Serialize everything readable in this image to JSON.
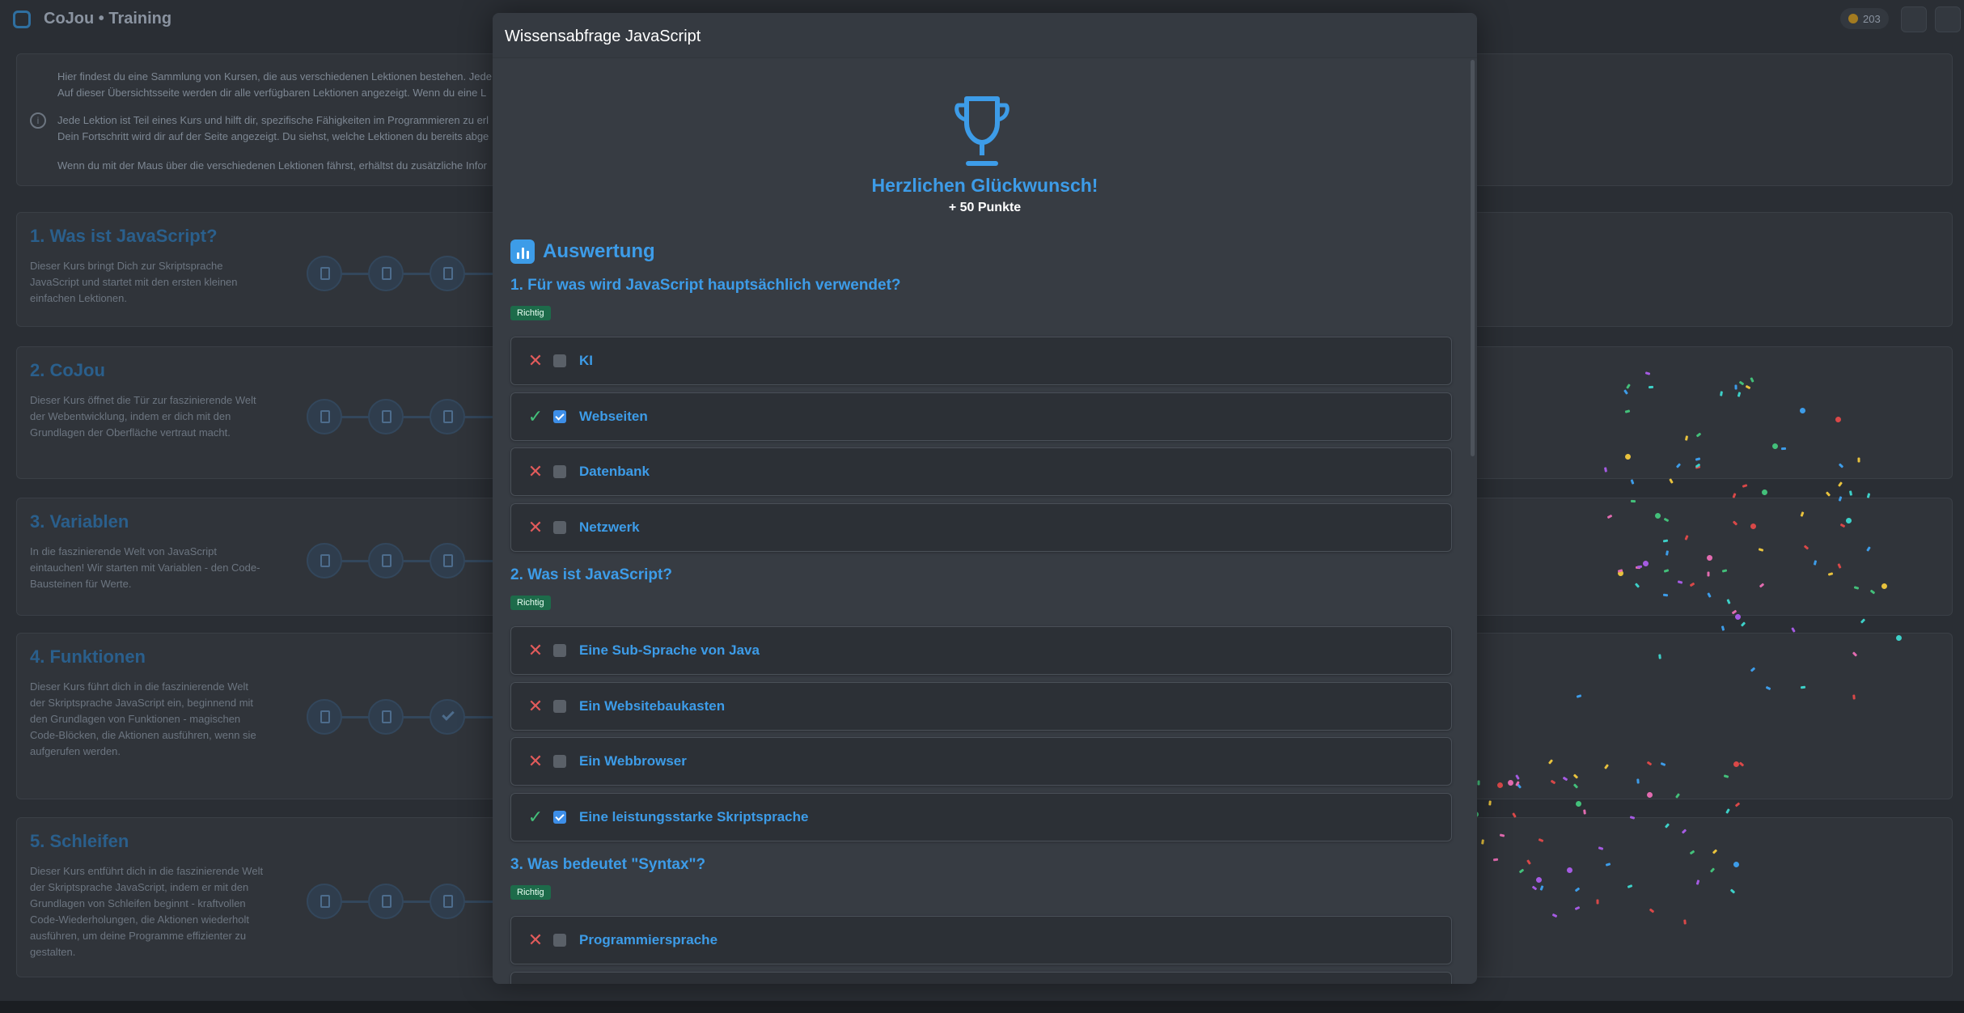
{
  "app": {
    "brand": "CoJou • Training",
    "points_badge": "203"
  },
  "info": {
    "lines": [
      "Hier findest du eine Sammlung von Kursen, die aus verschiedenen Lektionen bestehen. Jede",
      "Auf dieser Übersichtsseite werden dir alle verfügbaren Lektionen angezeigt. Wenn du eine L",
      "Jede Lektion ist Teil eines Kurs und hilft dir, spezifische Fähigkeiten im Programmieren zu erl",
      "Dein Fortschritt wird dir auf der Seite angezeigt. Du siehst, welche Lektionen du bereits abge",
      "Wenn du mit der Maus über die verschiedenen Lektionen fährst, erhältst du zusätzliche Infor"
    ]
  },
  "courses": [
    {
      "title": "1. Was ist JavaScript?",
      "desc": "Dieser Kurs bringt Dich zur Skriptsprache JavaScript und startet mit den ersten kleinen einfachen Lektionen."
    },
    {
      "title": "2. CoJou",
      "desc": "Dieser Kurs öffnet die Tür zur faszinierende Welt der Webentwicklung, indem er dich mit den Grundlagen der Oberfläche vertraut macht."
    },
    {
      "title": "3. Variablen",
      "desc": "In die faszinierende Welt von JavaScript eintauchen! Wir starten mit Variablen - den Code-Bausteinen für Werte."
    },
    {
      "title": "4. Funktionen",
      "desc": "Dieser Kurs führt dich in die faszinierende Welt der Skriptsprache JavaScript ein, beginnend mit den Grundlagen von Funktionen - magischen Code-Blöcken, die Aktionen ausführen, wenn sie aufgerufen werden."
    },
    {
      "title": "5. Schleifen",
      "desc": "Dieser Kurs entführt dich in die faszinierende Welt der Skriptsprache JavaScript, indem er mit den Grundlagen von Schleifen beginnt - kraftvollen Code-Wiederholungen, die Aktionen wiederholt ausführen, um deine Programme effizienter zu gestalten."
    }
  ],
  "modal": {
    "title": "Wissensabfrage JavaScript",
    "congrats": "Herzlichen Glückwunsch!",
    "points": "+ 50 Punkte",
    "evaluation_title": "Auswertung",
    "questions": [
      {
        "text": "1. Für was wird JavaScript hauptsächlich verwendet?",
        "status": "Richtig",
        "answers": [
          {
            "label": "KI",
            "correct": false,
            "checked": false
          },
          {
            "label": "Webseiten",
            "correct": true,
            "checked": true
          },
          {
            "label": "Datenbank",
            "correct": false,
            "checked": false
          },
          {
            "label": "Netzwerk",
            "correct": false,
            "checked": false
          }
        ]
      },
      {
        "text": "2. Was ist JavaScript?",
        "status": "Richtig",
        "answers": [
          {
            "label": "Eine Sub-Sprache von Java",
            "correct": false,
            "checked": false
          },
          {
            "label": "Ein Websitebaukasten",
            "correct": false,
            "checked": false
          },
          {
            "label": "Ein Webbrowser",
            "correct": false,
            "checked": false
          },
          {
            "label": "Eine leistungsstarke Skriptsprache",
            "correct": true,
            "checked": true
          }
        ]
      },
      {
        "text": "3. Was bedeutet \"Syntax\"?",
        "status": "Richtig",
        "answers": [
          {
            "label": "Programmiersprache",
            "correct": false,
            "checked": false
          },
          {
            "label": "",
            "correct": false,
            "checked": false
          }
        ]
      }
    ]
  },
  "colors": {
    "accent": "#3d9ce8",
    "correct": "#43c07a",
    "wrong": "#e25b5b",
    "badge": "#1d6b4a"
  }
}
